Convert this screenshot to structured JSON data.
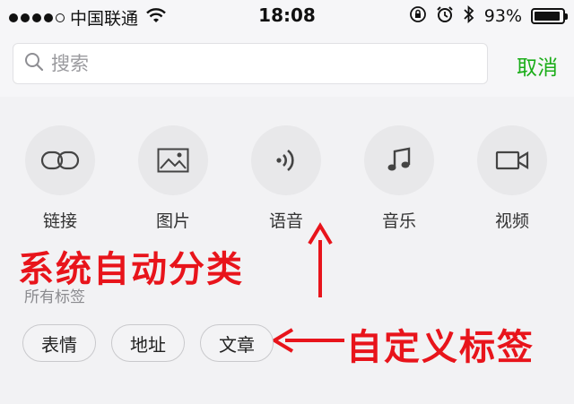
{
  "status_bar": {
    "carrier": "中国联通",
    "time": "18:08",
    "battery": "93%",
    "battery_level": 0.93
  },
  "search": {
    "placeholder": "搜索",
    "cancel_label": "取消"
  },
  "categories": [
    {
      "label": "链接",
      "icon": "link-icon"
    },
    {
      "label": "图片",
      "icon": "image-icon"
    },
    {
      "label": "语音",
      "icon": "voice-icon"
    },
    {
      "label": "音乐",
      "icon": "music-icon"
    },
    {
      "label": "视频",
      "icon": "video-icon"
    }
  ],
  "annotations": {
    "system": "系统自动分类",
    "custom": "自定义标签"
  },
  "tags_section": {
    "title": "所有标签",
    "tags": [
      "表情",
      "地址",
      "文章"
    ]
  },
  "colors": {
    "accent": "#1aad19",
    "annotation": "#e8141b"
  }
}
